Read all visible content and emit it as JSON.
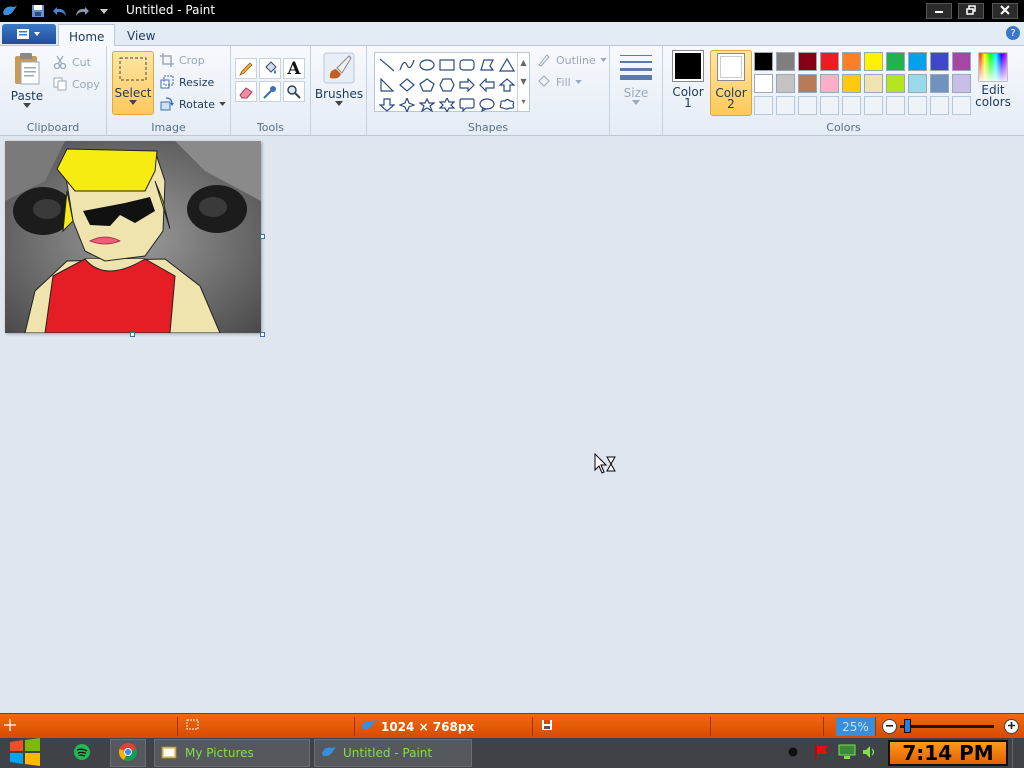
{
  "window": {
    "title": "Untitled - Paint",
    "minimize_icon": "minimize-icon",
    "maximize_icon": "restore-icon",
    "close_icon": "close-icon"
  },
  "quick_access": {
    "app_icon": "paint-app-icon",
    "save_icon": "save-icon",
    "undo_icon": "undo-icon",
    "redo_icon": "redo-icon",
    "customize_icon": "chevron-down-icon"
  },
  "tabs": [
    {
      "label": "Home",
      "active": true
    },
    {
      "label": "View",
      "active": false
    }
  ],
  "help_label": "?",
  "ribbon": {
    "clipboard": {
      "label": "Clipboard",
      "paste": "Paste",
      "cut": "Cut",
      "copy": "Copy"
    },
    "image": {
      "label": "Image",
      "select": "Select",
      "crop": "Crop",
      "resize": "Resize",
      "rotate": "Rotate"
    },
    "tools": {
      "label": "Tools",
      "items": [
        "pencil-icon",
        "fill-icon",
        "text-icon",
        "eraser-icon",
        "color-picker-icon",
        "magnifier-icon"
      ]
    },
    "brushes": {
      "label": "Brushes"
    },
    "shapes": {
      "label": "Shapes",
      "outline": "Outline",
      "fill": "Fill",
      "items": [
        "line",
        "curve",
        "oval",
        "rectangle",
        "rounded-rectangle",
        "polygon",
        "triangle",
        "right-triangle",
        "diamond",
        "pentagon",
        "hexagon",
        "right-arrow",
        "left-arrow",
        "up-arrow",
        "down-arrow",
        "four-point-star",
        "five-point-star",
        "six-point-star",
        "rounded-callout",
        "oval-callout",
        "cloud-callout"
      ]
    },
    "size": {
      "label": "Size"
    },
    "colors": {
      "label": "Colors",
      "color1_line1": "Color",
      "color1_line2": "1",
      "color2_line1": "Color",
      "color2_line2": "2",
      "color1": "#000000",
      "color2": "#ffffff",
      "edit_line1": "Edit",
      "edit_line2": "colors",
      "palette_row1": [
        "#000000",
        "#7f7f7f",
        "#880015",
        "#ed1c24",
        "#ff7f27",
        "#fff200",
        "#22b14c",
        "#00a2e8",
        "#3f48cc",
        "#a349a4"
      ],
      "palette_row2": [
        "#ffffff",
        "#c3c3c3",
        "#b97a57",
        "#ffaec9",
        "#ffc90e",
        "#efe4b0",
        "#b5e61d",
        "#99d9ea",
        "#7092be",
        "#c8bfe7"
      ]
    }
  },
  "statusbar": {
    "dimensions": "1024 × 768px",
    "zoom": "25%",
    "zoom_fraction": 0.05
  },
  "taskbar": {
    "start_icon": "windows-start-icon",
    "pinned": [
      "spotify-icon",
      "chrome-icon"
    ],
    "tasks": [
      {
        "label": "My Pictures",
        "icon": "folder-icon"
      },
      {
        "label": "Untitled - Paint",
        "icon": "paint-app-icon"
      }
    ],
    "tray": [
      "record-icon",
      "flag-icon",
      "network-icon",
      "volume-icon"
    ],
    "clock": "7:14 PM"
  }
}
